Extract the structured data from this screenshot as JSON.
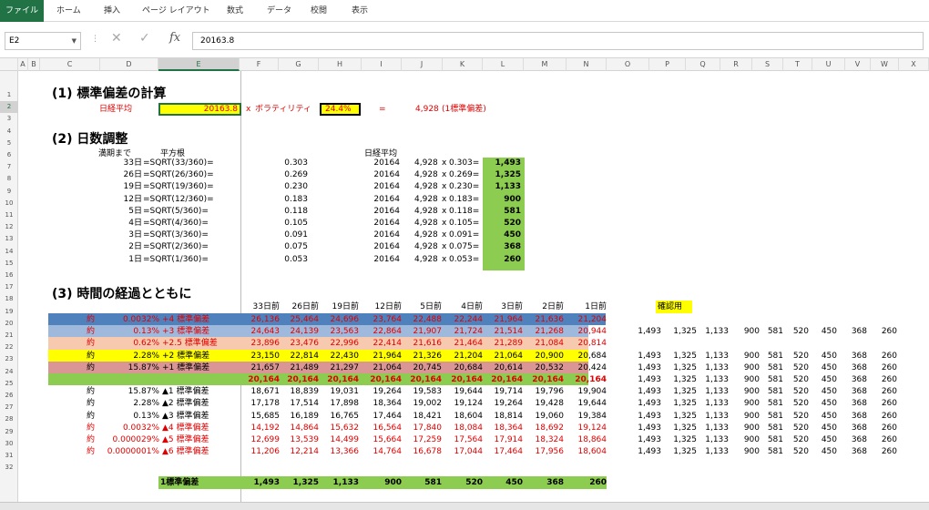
{
  "ribbon": {
    "tabs": [
      "ファイル",
      "ホーム",
      "挿入",
      "ページ レイアウト",
      "数式",
      "データ",
      "校閲",
      "表示"
    ],
    "active_tab": "ファイル",
    "accent_color": "#217346"
  },
  "formula_bar": {
    "name_box": "E2",
    "formula": "20163.8",
    "icons": [
      "cancel-icon",
      "enter-icon",
      "function-icon"
    ],
    "fx_label": "fx"
  },
  "columns": [
    "A",
    "B",
    "C",
    "D",
    "E",
    "F",
    "G",
    "H",
    "I",
    "J",
    "K",
    "L",
    "M",
    "N",
    "O",
    "P",
    "Q",
    "R",
    "S",
    "T",
    "U",
    "V",
    "W",
    "X"
  ],
  "selected_cell": "E2",
  "rows": [
    "1",
    "2",
    "3",
    "4",
    "5",
    "6",
    "7",
    "8",
    "9",
    "10",
    "11",
    "12",
    "13",
    "14",
    "15",
    "16",
    "17",
    "18",
    "19",
    "20",
    "21",
    "22",
    "23",
    "24",
    "25",
    "26",
    "27",
    "28",
    "29",
    "30",
    "31",
    "32"
  ],
  "section1": {
    "heading": "(1) 標準偏差の計算",
    "avg_label": "日経平均",
    "avg_value": "20163.8",
    "times": "x",
    "vol_label": "ボラティリティ",
    "vol_value": "24.4%",
    "equals": "=",
    "result": "4,928",
    "result_label": "(1標準偏差)"
  },
  "section2": {
    "heading": "(2) 日数調整",
    "hdr_days": "満期まで",
    "hdr_sqrt": "平方根",
    "hdr_avg": "日経平均",
    "times": "x",
    "rows": [
      {
        "days": "33日",
        "formula": "=SQRT(33/360)=",
        "sqrt": "0.303",
        "avg": "20164",
        "sd": "4,928",
        "sqrt2": "0.303=",
        "result": "1,493"
      },
      {
        "days": "26日",
        "formula": "=SQRT(26/360)=",
        "sqrt": "0.269",
        "avg": "20164",
        "sd": "4,928",
        "sqrt2": "0.269=",
        "result": "1,325"
      },
      {
        "days": "19日",
        "formula": "=SQRT(19/360)=",
        "sqrt": "0.230",
        "avg": "20164",
        "sd": "4,928",
        "sqrt2": "0.230=",
        "result": "1,133"
      },
      {
        "days": "12日",
        "formula": "=SQRT(12/360)=",
        "sqrt": "0.183",
        "avg": "20164",
        "sd": "4,928",
        "sqrt2": "0.183=",
        "result": "900"
      },
      {
        "days": "5日",
        "formula": "=SQRT(5/360)=",
        "sqrt": "0.118",
        "avg": "20164",
        "sd": "4,928",
        "sqrt2": "0.118=",
        "result": "581"
      },
      {
        "days": "4日",
        "formula": "=SQRT(4/360)=",
        "sqrt": "0.105",
        "avg": "20164",
        "sd": "4,928",
        "sqrt2": "0.105=",
        "result": "520"
      },
      {
        "days": "3日",
        "formula": "=SQRT(3/360)=",
        "sqrt": "0.091",
        "avg": "20164",
        "sd": "4,928",
        "sqrt2": "0.091=",
        "result": "450"
      },
      {
        "days": "2日",
        "formula": "=SQRT(2/360)=",
        "sqrt": "0.075",
        "avg": "20164",
        "sd": "4,928",
        "sqrt2": "0.075=",
        "result": "368"
      },
      {
        "days": "1日",
        "formula": "=SQRT(1/360)=",
        "sqrt": "0.053",
        "avg": "20164",
        "sd": "4,928",
        "sqrt2": "0.053=",
        "result": "260"
      }
    ]
  },
  "section3": {
    "heading": "(3) 時間の経過とともに",
    "col_headers": [
      "33日前",
      "26日前",
      "19日前",
      "12日前",
      "5日前",
      "4日前",
      "3日前",
      "2日前",
      "1日前"
    ],
    "confirm_label": "確認用",
    "rows": [
      {
        "pre": "約",
        "pct": "0.0032%",
        "label": "+4 標準偏差",
        "values": [
          "26,136",
          "25,464",
          "24,696",
          "23,764",
          "22,488",
          "22,244",
          "21,964",
          "21,636",
          "21,204"
        ],
        "check": [],
        "style": "blue"
      },
      {
        "pre": "約",
        "pct": "0.13%",
        "label": "+3 標準偏差",
        "values": [
          "24,643",
          "24,139",
          "23,563",
          "22,864",
          "21,907",
          "21,724",
          "21,514",
          "21,268",
          "20,944"
        ],
        "check": [
          "1,493",
          "1,325",
          "1,133",
          "900",
          "581",
          "520",
          "450",
          "368",
          "260"
        ],
        "style": "lightblue"
      },
      {
        "pre": "約",
        "pct": "0.62%",
        "label": "+2.5 標準偏差",
        "values": [
          "23,896",
          "23,476",
          "22,996",
          "22,414",
          "21,616",
          "21,464",
          "21,289",
          "21,084",
          "20,814"
        ],
        "check": [],
        "style": "peach"
      },
      {
        "pre": "約",
        "pct": "2.28%",
        "label": "+2 標準偏差",
        "values": [
          "23,150",
          "22,814",
          "22,430",
          "21,964",
          "21,326",
          "21,204",
          "21,064",
          "20,900",
          "20,684"
        ],
        "check": [
          "1,493",
          "1,325",
          "1,133",
          "900",
          "581",
          "520",
          "450",
          "368",
          "260"
        ],
        "style": "yellow"
      },
      {
        "pre": "約",
        "pct": "15.87%",
        "label": "+1 標準偏差",
        "values": [
          "21,657",
          "21,489",
          "21,297",
          "21,064",
          "20,745",
          "20,684",
          "20,614",
          "20,532",
          "20,424"
        ],
        "check": [
          "1,493",
          "1,325",
          "1,133",
          "900",
          "581",
          "520",
          "450",
          "368",
          "260"
        ],
        "style": "rose"
      },
      {
        "pre": "",
        "pct": "",
        "label": "",
        "values": [
          "20,164",
          "20,164",
          "20,164",
          "20,164",
          "20,164",
          "20,164",
          "20,164",
          "20,164",
          "20,164"
        ],
        "check": [
          "1,493",
          "1,325",
          "1,133",
          "900",
          "581",
          "520",
          "450",
          "368",
          "260"
        ],
        "style": "green"
      },
      {
        "pre": "約",
        "pct": "15.87%",
        "label": "▲1 標準偏差",
        "values": [
          "18,671",
          "18,839",
          "19,031",
          "19,264",
          "19,583",
          "19,644",
          "19,714",
          "19,796",
          "19,904"
        ],
        "check": [
          "1,493",
          "1,325",
          "1,133",
          "900",
          "581",
          "520",
          "450",
          "368",
          "260"
        ],
        "style": "none"
      },
      {
        "pre": "約",
        "pct": "2.28%",
        "label": "▲2 標準偏差",
        "values": [
          "17,178",
          "17,514",
          "17,898",
          "18,364",
          "19,002",
          "19,124",
          "19,264",
          "19,428",
          "19,644"
        ],
        "check": [
          "1,493",
          "1,325",
          "1,133",
          "900",
          "581",
          "520",
          "450",
          "368",
          "260"
        ],
        "style": "none"
      },
      {
        "pre": "約",
        "pct": "0.13%",
        "label": "▲3 標準偏差",
        "values": [
          "15,685",
          "16,189",
          "16,765",
          "17,464",
          "18,421",
          "18,604",
          "18,814",
          "19,060",
          "19,384"
        ],
        "check": [
          "1,493",
          "1,325",
          "1,133",
          "900",
          "581",
          "520",
          "450",
          "368",
          "260"
        ],
        "style": "none"
      },
      {
        "pre": "約",
        "pct": "0.0032%",
        "label": "▲4 標準偏差",
        "values": [
          "14,192",
          "14,864",
          "15,632",
          "16,564",
          "17,840",
          "18,084",
          "18,364",
          "18,692",
          "19,124"
        ],
        "check": [
          "1,493",
          "1,325",
          "1,133",
          "900",
          "581",
          "520",
          "450",
          "368",
          "260"
        ],
        "style": "redtext"
      },
      {
        "pre": "約",
        "pct": "0.000029%",
        "label": "▲5 標準偏差",
        "values": [
          "12,699",
          "13,539",
          "14,499",
          "15,664",
          "17,259",
          "17,564",
          "17,914",
          "18,324",
          "18,864"
        ],
        "check": [
          "1,493",
          "1,325",
          "1,133",
          "900",
          "581",
          "520",
          "450",
          "368",
          "260"
        ],
        "style": "redtext"
      },
      {
        "pre": "約",
        "pct": "0.0000001%",
        "label": "▲6 標準偏差",
        "values": [
          "11,206",
          "12,214",
          "13,366",
          "14,764",
          "16,678",
          "17,044",
          "17,464",
          "17,956",
          "18,604"
        ],
        "check": [
          "1,493",
          "1,325",
          "1,133",
          "900",
          "581",
          "520",
          "450",
          "368",
          "260"
        ],
        "style": "redtext"
      }
    ],
    "total_label": "1標準偏差",
    "total_values": [
      "1,493",
      "1,325",
      "1,133",
      "900",
      "581",
      "520",
      "450",
      "368",
      "260"
    ]
  },
  "colors": {
    "blue": "#4f81bd",
    "lightblue": "#9fb9dc",
    "peach": "#f7c9ae",
    "yellow": "#ffff00",
    "rose": "#d99694",
    "green": "#8ccc50",
    "red": "#e00000"
  }
}
